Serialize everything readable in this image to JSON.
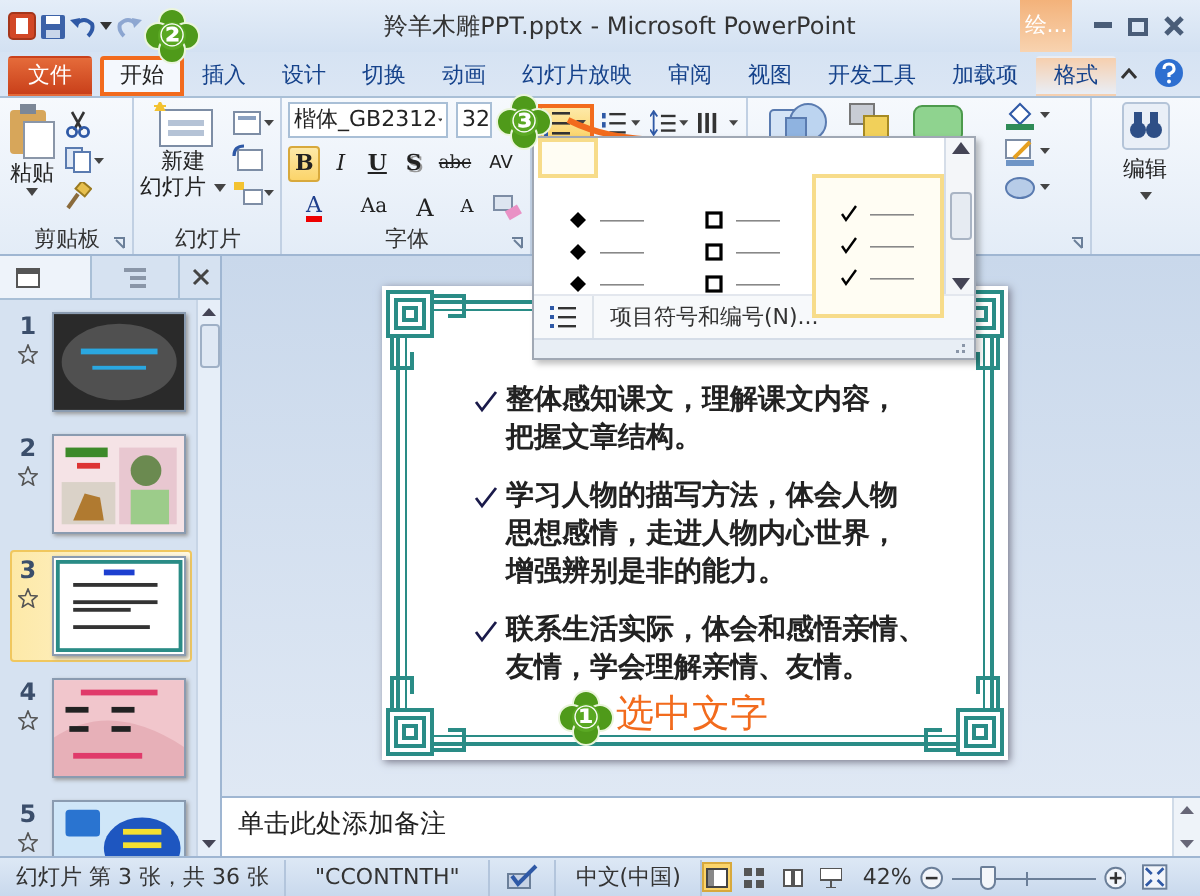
{
  "window": {
    "title": "羚羊木雕PPT.pptx - Microsoft PowerPoint",
    "context_tab": "绘..."
  },
  "tabs": [
    {
      "label": "文件",
      "kind": "file",
      "selected": false,
      "outlined": false
    },
    {
      "label": "开始",
      "kind": "tab",
      "selected": true,
      "outlined": true
    },
    {
      "label": "插入",
      "kind": "tab",
      "selected": false,
      "outlined": false
    },
    {
      "label": "设计",
      "kind": "tab",
      "selected": false,
      "outlined": false
    },
    {
      "label": "切换",
      "kind": "tab",
      "selected": false,
      "outlined": false
    },
    {
      "label": "动画",
      "kind": "tab",
      "selected": false,
      "outlined": false
    },
    {
      "label": "幻灯片放映",
      "kind": "tab",
      "selected": false,
      "outlined": false
    },
    {
      "label": "审阅",
      "kind": "tab",
      "selected": false,
      "outlined": false
    },
    {
      "label": "视图",
      "kind": "tab",
      "selected": false,
      "outlined": false
    },
    {
      "label": "开发工具",
      "kind": "tab",
      "selected": false,
      "outlined": false
    },
    {
      "label": "加载项",
      "kind": "tab",
      "selected": false,
      "outlined": false
    },
    {
      "label": "格式",
      "kind": "context",
      "selected": false,
      "outlined": false
    }
  ],
  "ribbon": {
    "clipboard": {
      "label": "剪贴板",
      "paste": "粘贴"
    },
    "slides": {
      "label": "幻灯片",
      "new_slide_top": "新建",
      "new_slide_bottom": "幻灯片"
    },
    "font": {
      "label": "字体",
      "font_name": "楷体_GB2312",
      "font_size": "32",
      "styles": [
        {
          "label": "B",
          "kind": "bold",
          "selected": true
        },
        {
          "label": "I",
          "kind": "italic",
          "selected": false
        },
        {
          "label": "U",
          "kind": "underline",
          "selected": false
        },
        {
          "label": "S",
          "kind": "shadow",
          "selected": false
        },
        {
          "label": "abc",
          "kind": "strike",
          "selected": false
        },
        {
          "label": "AV",
          "kind": "spacing",
          "selected": false
        }
      ],
      "font_color": "A",
      "change_case": "Aa",
      "grow": "A",
      "shrink": "A"
    },
    "paragraph": {
      "bullets_outlined": true,
      "bullets_selected": true
    },
    "editing": {
      "label": "编辑"
    }
  },
  "bullet_gallery": {
    "items": [
      {
        "kind": "blank",
        "highlighted": true
      },
      {
        "kind": "diamond",
        "highlighted": false
      },
      {
        "kind": "square",
        "highlighted": false
      },
      {
        "kind": "check",
        "highlighted": true
      }
    ],
    "footer": "项目符号和编号(N)..."
  },
  "slide_panel": {
    "thumbnails": [
      {
        "number": "1",
        "selected": false
      },
      {
        "number": "2",
        "selected": false
      },
      {
        "number": "3",
        "selected": true
      },
      {
        "number": "4",
        "selected": false
      },
      {
        "number": "5",
        "selected": false
      }
    ]
  },
  "slide": {
    "bullets": [
      {
        "lines": [
          "整体感知课文，理解课文内容，",
          "把握文章结构。"
        ]
      },
      {
        "lines": [
          "学习人物的描写方法，体会人物",
          "思想感情，走进人物内心世界，",
          "增强辨别是非的能力。"
        ]
      },
      {
        "lines": [
          "联系生活实际，体会和感悟亲情、",
          "友情，学会理解亲情、友情。"
        ]
      }
    ]
  },
  "notes": {
    "text": "单击此处添加备注"
  },
  "status_bar": {
    "slide_info": "幻灯片 第 3 张，共 36 张",
    "theme": "\"CCONTNTH\"",
    "language": "中文(中国)",
    "views": [
      {
        "kind": "normal",
        "selected": true
      },
      {
        "kind": "sorter",
        "selected": false
      },
      {
        "kind": "reading",
        "selected": false
      },
      {
        "kind": "slideshow",
        "selected": false
      }
    ],
    "zoom": "42%",
    "zoom_slider": {
      "level": 0.22
    }
  },
  "annotations": [
    {
      "label": "②"
    },
    {
      "label": "③"
    },
    {
      "label": "①",
      "caption": "选中文字"
    }
  ]
}
